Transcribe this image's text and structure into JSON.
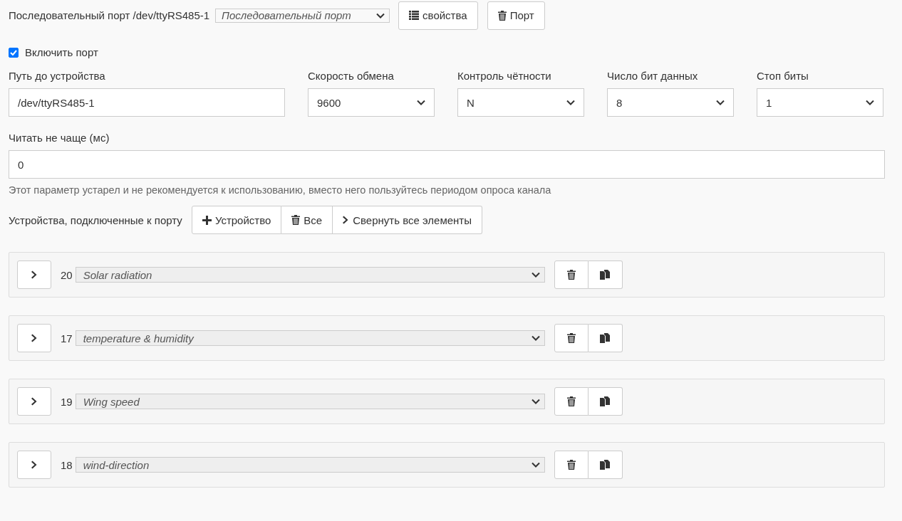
{
  "header": {
    "title": "Последовательный порт /dev/ttyRS485-1",
    "type_select": "Последовательный порт",
    "buttons": [
      {
        "kind": "list",
        "label": "свойства"
      },
      {
        "kind": "trash",
        "label": "Порт"
      }
    ]
  },
  "enable": {
    "label": "Включить порт",
    "checked": true
  },
  "fields": [
    {
      "kind": "input",
      "label": "Путь до устройства",
      "value": "/dev/ttyRS485-1"
    },
    {
      "kind": "select",
      "label": "Скорость обмена",
      "value": "9600"
    },
    {
      "kind": "select",
      "label": "Контроль чётности",
      "value": "N"
    },
    {
      "kind": "select",
      "label": "Число бит данных",
      "value": "8"
    },
    {
      "kind": "select",
      "label": "Стоп биты",
      "value": "1"
    }
  ],
  "read_interval": {
    "label": "Читать не чаще (мс)",
    "value": "0",
    "help": "Этот параметр устарел и не рекомендуется к использованию, вместо него пользуйтесь периодом опроса канала"
  },
  "devices": {
    "label": "Устройства, подключенные к порту",
    "buttons": [
      {
        "kind": "plus",
        "label": "Устройство"
      },
      {
        "kind": "trash",
        "label": "Все"
      },
      {
        "kind": "chevron",
        "label": "Свернуть все элементы"
      }
    ],
    "items": [
      {
        "address": "20",
        "template": "Solar radiation"
      },
      {
        "address": "17",
        "template": "temperature & humidity"
      },
      {
        "address": "19",
        "template": "Wing speed"
      },
      {
        "address": "18",
        "template": "wind-direction"
      }
    ]
  }
}
